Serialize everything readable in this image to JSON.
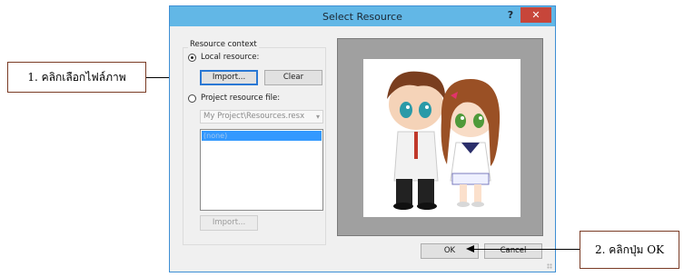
{
  "dialog": {
    "title": "Select Resource",
    "help_label": "?",
    "close_label": "✕",
    "resource_context_label": "Resource context",
    "local_resource_label": "Local resource:",
    "import_label": "Import...",
    "clear_label": "Clear",
    "project_resource_label": "Project resource file:",
    "project_file_value": "My Project\\Resources.resx",
    "list_items": [
      "(none)"
    ],
    "import2_label": "Import...",
    "ok_label": "OK",
    "cancel_label": "Cancel"
  },
  "annotations": {
    "step1": "1. คลิกเลือกไฟล์ภาพ",
    "step2": "2. คลิกปุ่ม OK"
  },
  "colors": {
    "titlebar": "#62b7e6",
    "close": "#c7463a",
    "selection": "#3399ff",
    "preview_bg": "#a0a0a0"
  },
  "icons": {
    "help": "help-icon",
    "close": "close-icon",
    "dropdown": "chevron-down-icon"
  }
}
